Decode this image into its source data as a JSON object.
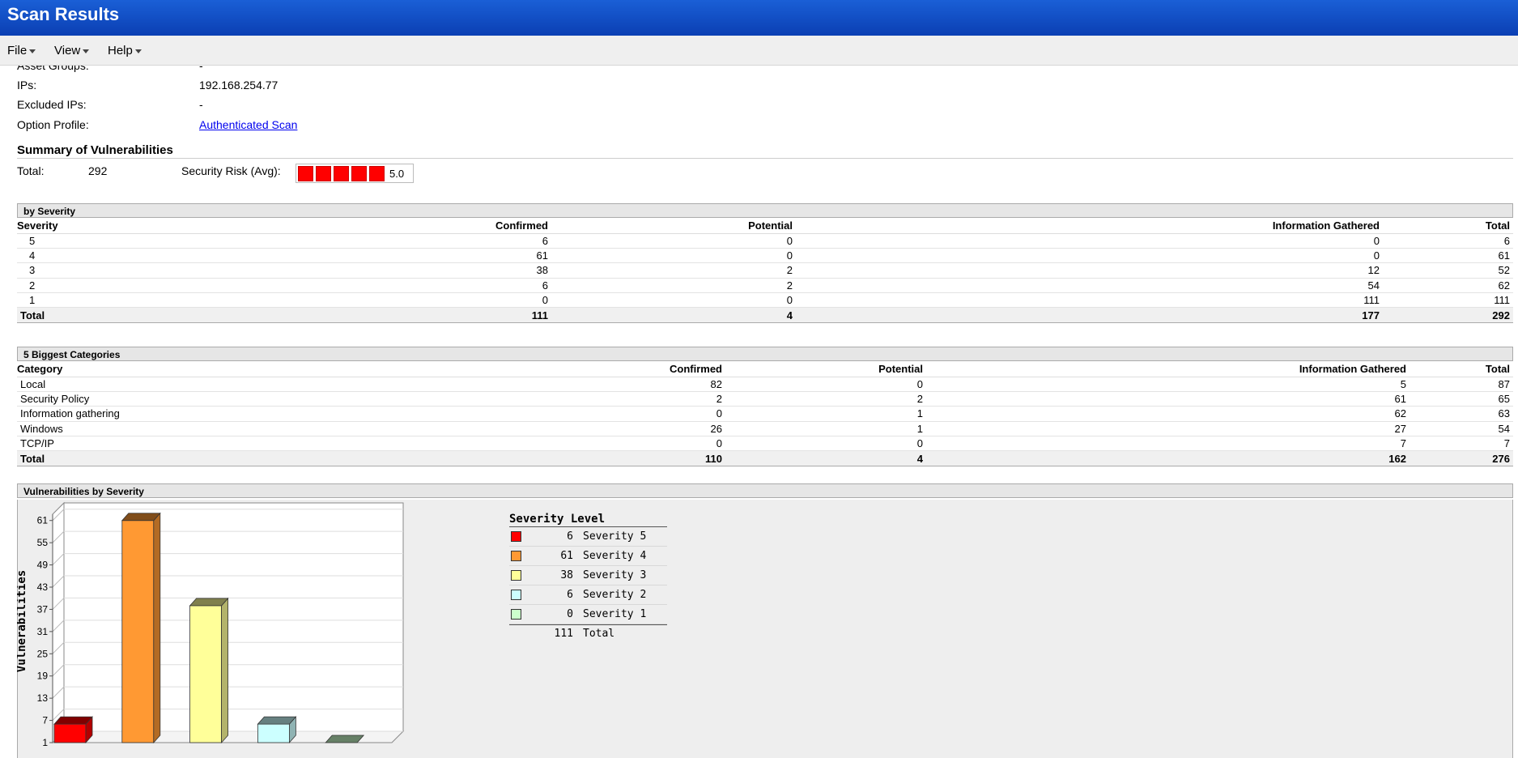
{
  "window": {
    "title": "Scan Results"
  },
  "menu": [
    {
      "label": "File"
    },
    {
      "label": "View"
    },
    {
      "label": "Help"
    }
  ],
  "details": {
    "asset_groups_label": "Asset Groups:",
    "asset_groups_value": "-",
    "ips_label": "IPs:",
    "ips_value": "192.168.254.77",
    "excluded_label": "Excluded IPs:",
    "excluded_value": "-",
    "option_profile_label": "Option Profile:",
    "option_profile_value": "Authenticated Scan"
  },
  "summary": {
    "title": "Summary of Vulnerabilities",
    "total_label": "Total:",
    "total_value": "292",
    "risk_label": "Security Risk (Avg):",
    "risk_value": "5.0",
    "risk_color": "#ff0000"
  },
  "by_severity": {
    "header": "by Severity",
    "columns": [
      "Severity",
      "Confirmed",
      "Potential",
      "Information Gathered",
      "Total"
    ],
    "rows": [
      [
        "5",
        "6",
        "0",
        "0",
        "6"
      ],
      [
        "4",
        "61",
        "0",
        "0",
        "61"
      ],
      [
        "3",
        "38",
        "2",
        "12",
        "52"
      ],
      [
        "2",
        "6",
        "2",
        "54",
        "62"
      ],
      [
        "1",
        "0",
        "0",
        "111",
        "111"
      ]
    ],
    "total": [
      "Total",
      "111",
      "4",
      "177",
      "292"
    ]
  },
  "categories": {
    "header": "5 Biggest Categories",
    "columns": [
      "Category",
      "Confirmed",
      "Potential",
      "Information Gathered",
      "Total"
    ],
    "rows": [
      [
        "Local",
        "82",
        "0",
        "5",
        "87"
      ],
      [
        "Security Policy",
        "2",
        "2",
        "61",
        "65"
      ],
      [
        "Information gathering",
        "0",
        "1",
        "62",
        "63"
      ],
      [
        "Windows",
        "26",
        "1",
        "27",
        "54"
      ],
      [
        "TCP/IP",
        "0",
        "0",
        "7",
        "7"
      ]
    ],
    "total": [
      "Total",
      "110",
      "4",
      "162",
      "276"
    ]
  },
  "vuln_chart": {
    "header": "Vulnerabilities by Severity",
    "legend_title": "Severity Level",
    "legend": [
      {
        "count": "6",
        "label": "Severity 5",
        "color": "#ff0000"
      },
      {
        "count": "61",
        "label": "Severity 4",
        "color": "#ff9933"
      },
      {
        "count": "38",
        "label": "Severity 3",
        "color": "#ffff99"
      },
      {
        "count": "6",
        "label": "Severity 2",
        "color": "#ccffff"
      },
      {
        "count": "0",
        "label": "Severity 1",
        "color": "#ccffcc"
      }
    ],
    "legend_total_count": "111",
    "legend_total_label": "Total"
  },
  "chart_data": {
    "type": "bar",
    "ylabel": "Vulnerabilities",
    "categories": [
      "Severity 5",
      "Severity 4",
      "Severity 3",
      "Severity 2",
      "Severity 1"
    ],
    "values": [
      6,
      61,
      38,
      6,
      0
    ],
    "colors": [
      "#ff0000",
      "#ff9933",
      "#ffff99",
      "#ccffff",
      "#ccffcc"
    ],
    "yticks": [
      "1",
      "7",
      "13",
      "19",
      "25",
      "31",
      "37",
      "43",
      "49",
      "55",
      "61"
    ],
    "ylim": [
      1,
      64
    ],
    "grid": true
  }
}
